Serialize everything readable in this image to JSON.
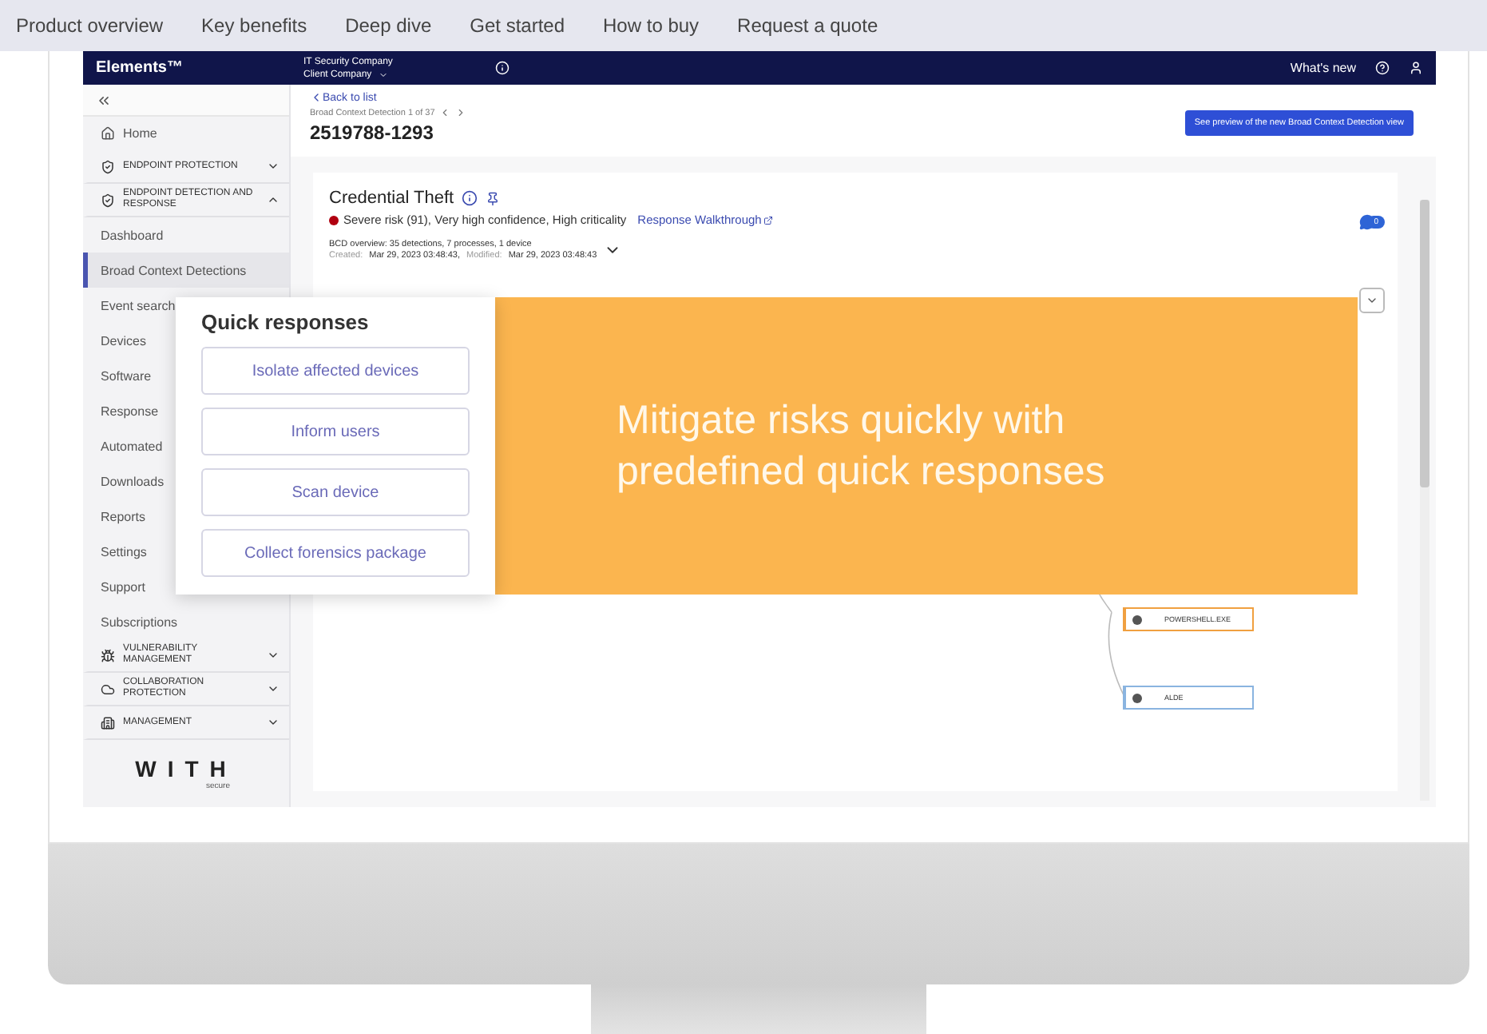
{
  "site_nav": {
    "links": [
      "Product overview",
      "Key benefits",
      "Deep dive",
      "Get started",
      "How to buy",
      "Request a quote"
    ]
  },
  "topbar": {
    "brand": "Elements™",
    "org": "IT Security Company",
    "client": "Client Company",
    "whats_new": "What's new"
  },
  "sidebar": {
    "items": [
      {
        "kind": "link",
        "label": "Home"
      },
      {
        "kind": "section",
        "label": "ENDPOINT PROTECTION",
        "expanded": false
      },
      {
        "kind": "section",
        "label": "ENDPOINT DETECTION AND RESPONSE",
        "expanded": true
      },
      {
        "kind": "sub",
        "label": "Dashboard",
        "selected": false
      },
      {
        "kind": "sub",
        "label": "Broad Context Detections",
        "selected": true
      },
      {
        "kind": "sub",
        "label": "Event search",
        "selected": false
      },
      {
        "kind": "sub",
        "label": "Devices",
        "selected": false
      },
      {
        "kind": "sub",
        "label": "Software",
        "selected": false
      },
      {
        "kind": "sub",
        "label": "Response",
        "selected": false
      },
      {
        "kind": "sub",
        "label": "Automated",
        "selected": false
      },
      {
        "kind": "sub",
        "label": "Downloads",
        "selected": false
      },
      {
        "kind": "sub",
        "label": "Reports",
        "selected": false
      },
      {
        "kind": "sub",
        "label": "Settings",
        "selected": false
      },
      {
        "kind": "sub",
        "label": "Support",
        "selected": false
      },
      {
        "kind": "sub",
        "label": "Subscriptions",
        "selected": false
      },
      {
        "kind": "section",
        "label": "VULNERABILITY MANAGEMENT",
        "expanded": false
      },
      {
        "kind": "section",
        "label": "COLLABORATION PROTECTION",
        "expanded": false
      },
      {
        "kind": "section",
        "label": "MANAGEMENT",
        "expanded": false
      }
    ],
    "logo": "WITH",
    "logo_sub": "secure"
  },
  "header": {
    "back": "Back to list",
    "pager": "Broad Context Detection 1 of 37",
    "id": "2519788-1293",
    "preview_button": "See preview of the new Broad Context Detection view"
  },
  "detection": {
    "title": "Credential Theft",
    "risk": "Severe risk (91), Very high confidence, High criticality",
    "walkthrough": "Response Walkthrough",
    "overview": "BCD overview: 35 detections, 7 processes, 1 device",
    "created_label": "Created:",
    "created": "Mar 29, 2023 03:48:43,",
    "modified_label": "Modified:",
    "modified": "Mar 29, 2023 03:48:43",
    "comments": "0",
    "nodes": [
      {
        "label": "POWERSHELL.EXE",
        "color": "#f0a040"
      },
      {
        "label": "ALDE",
        "color": "#8ab4e0"
      }
    ]
  },
  "quick_responses": {
    "title": "Quick responses",
    "actions": [
      "Isolate affected devices",
      "Inform users",
      "Scan device",
      "Collect forensics package"
    ]
  },
  "banner": {
    "text": "Mitigate risks quickly with predefined quick responses"
  }
}
